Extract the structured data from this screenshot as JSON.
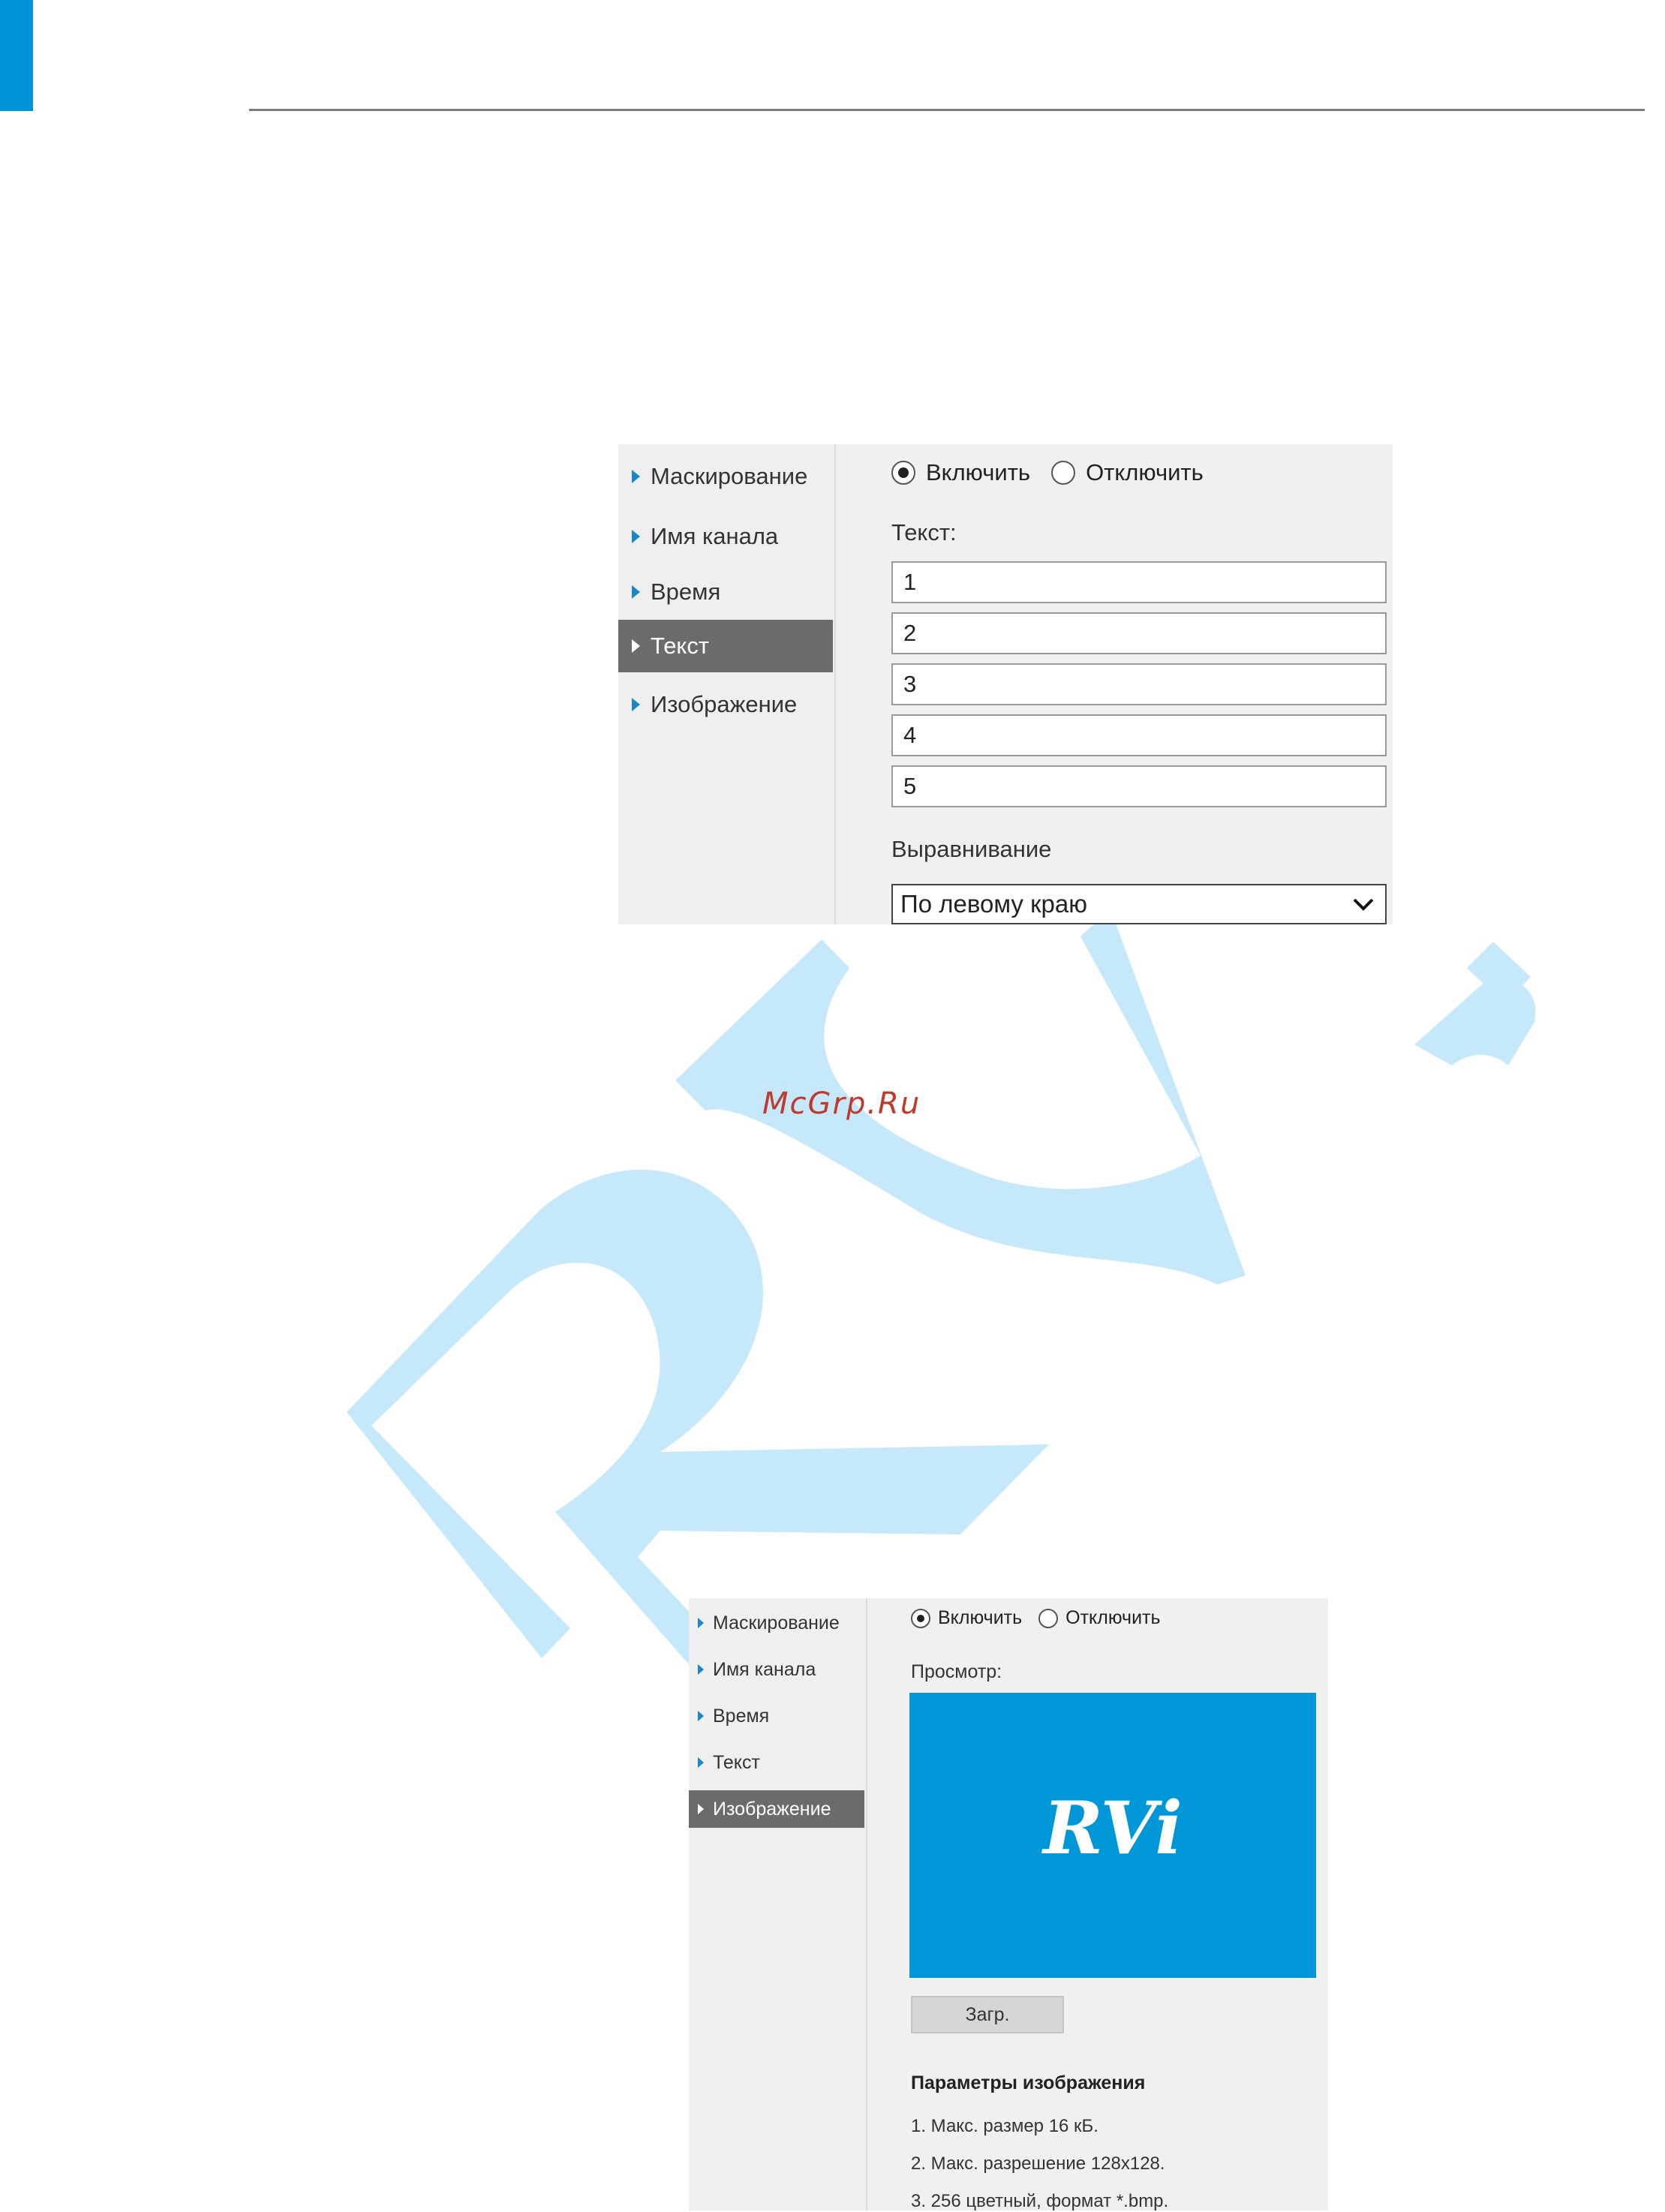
{
  "colors": {
    "brand_blue": "#0094d6",
    "watermark_blue": "#c5e8fa",
    "nav_active": "#6b6b6b",
    "mcgrp_red": "#c0392b"
  },
  "watermark": {
    "letters": "RVi"
  },
  "panel_text": {
    "nav": [
      {
        "label": "Маскирование",
        "active": false
      },
      {
        "label": "Имя канала",
        "active": false
      },
      {
        "label": "Время",
        "active": false
      },
      {
        "label": "Текст",
        "active": true
      },
      {
        "label": "Изображение",
        "active": false
      }
    ],
    "enable_label": "Включить",
    "disable_label": "Отключить",
    "enabled": true,
    "text_label": "Текст:",
    "text_lines": [
      "1",
      "2",
      "3",
      "4",
      "5"
    ],
    "align_label": "Выравнивание",
    "align_value": "По левому краю"
  },
  "site_watermark": "McGrp.Ru",
  "panel_image": {
    "nav": [
      {
        "label": "Маскирование",
        "active": false
      },
      {
        "label": "Имя канала",
        "active": false
      },
      {
        "label": "Время",
        "active": false
      },
      {
        "label": "Текст",
        "active": false
      },
      {
        "label": "Изображение",
        "active": true
      }
    ],
    "enable_label": "Включить",
    "disable_label": "Отключить",
    "enabled": true,
    "preview_label": "Просмотр:",
    "preview_logo": "RVi",
    "upload_button": "Загр.",
    "params_title": "Параметры изображения",
    "params": [
      "1. Макс. размер 16 кБ.",
      "2. Макс. разрешение 128x128.",
      "3. 256 цветный, формат *.bmp."
    ]
  }
}
